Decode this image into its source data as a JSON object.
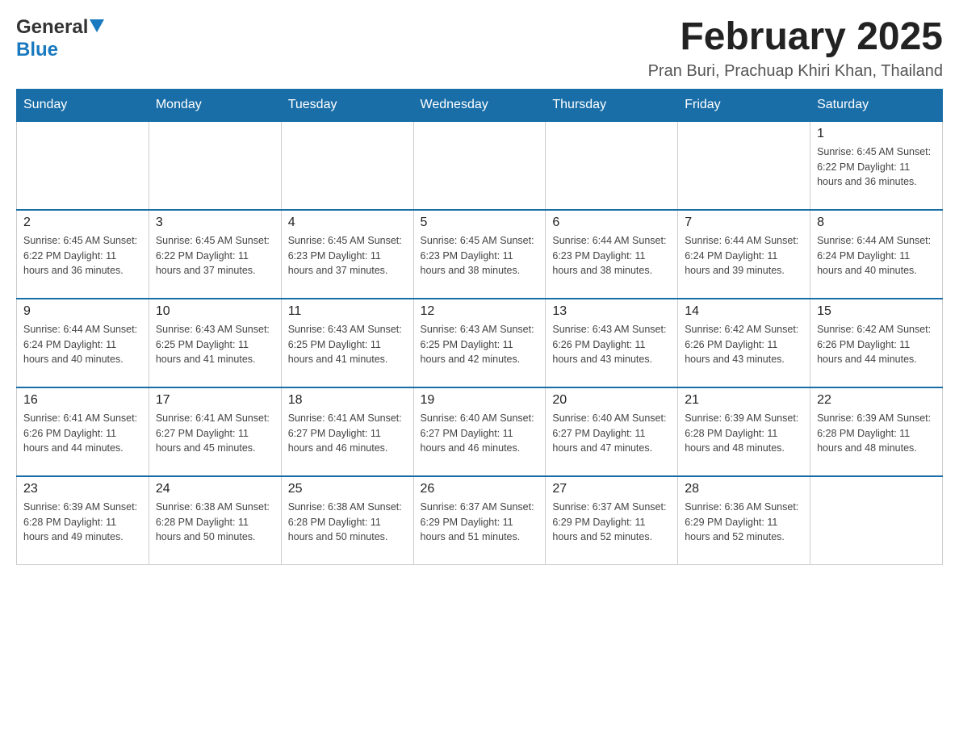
{
  "header": {
    "logo_general": "General",
    "logo_blue": "Blue",
    "month_title": "February 2025",
    "location": "Pran Buri, Prachuap Khiri Khan, Thailand"
  },
  "days_of_week": [
    "Sunday",
    "Monday",
    "Tuesday",
    "Wednesday",
    "Thursday",
    "Friday",
    "Saturday"
  ],
  "weeks": [
    {
      "days": [
        {
          "date": "",
          "info": ""
        },
        {
          "date": "",
          "info": ""
        },
        {
          "date": "",
          "info": ""
        },
        {
          "date": "",
          "info": ""
        },
        {
          "date": "",
          "info": ""
        },
        {
          "date": "",
          "info": ""
        },
        {
          "date": "1",
          "info": "Sunrise: 6:45 AM\nSunset: 6:22 PM\nDaylight: 11 hours\nand 36 minutes."
        }
      ]
    },
    {
      "days": [
        {
          "date": "2",
          "info": "Sunrise: 6:45 AM\nSunset: 6:22 PM\nDaylight: 11 hours\nand 36 minutes."
        },
        {
          "date": "3",
          "info": "Sunrise: 6:45 AM\nSunset: 6:22 PM\nDaylight: 11 hours\nand 37 minutes."
        },
        {
          "date": "4",
          "info": "Sunrise: 6:45 AM\nSunset: 6:23 PM\nDaylight: 11 hours\nand 37 minutes."
        },
        {
          "date": "5",
          "info": "Sunrise: 6:45 AM\nSunset: 6:23 PM\nDaylight: 11 hours\nand 38 minutes."
        },
        {
          "date": "6",
          "info": "Sunrise: 6:44 AM\nSunset: 6:23 PM\nDaylight: 11 hours\nand 38 minutes."
        },
        {
          "date": "7",
          "info": "Sunrise: 6:44 AM\nSunset: 6:24 PM\nDaylight: 11 hours\nand 39 minutes."
        },
        {
          "date": "8",
          "info": "Sunrise: 6:44 AM\nSunset: 6:24 PM\nDaylight: 11 hours\nand 40 minutes."
        }
      ]
    },
    {
      "days": [
        {
          "date": "9",
          "info": "Sunrise: 6:44 AM\nSunset: 6:24 PM\nDaylight: 11 hours\nand 40 minutes."
        },
        {
          "date": "10",
          "info": "Sunrise: 6:43 AM\nSunset: 6:25 PM\nDaylight: 11 hours\nand 41 minutes."
        },
        {
          "date": "11",
          "info": "Sunrise: 6:43 AM\nSunset: 6:25 PM\nDaylight: 11 hours\nand 41 minutes."
        },
        {
          "date": "12",
          "info": "Sunrise: 6:43 AM\nSunset: 6:25 PM\nDaylight: 11 hours\nand 42 minutes."
        },
        {
          "date": "13",
          "info": "Sunrise: 6:43 AM\nSunset: 6:26 PM\nDaylight: 11 hours\nand 43 minutes."
        },
        {
          "date": "14",
          "info": "Sunrise: 6:42 AM\nSunset: 6:26 PM\nDaylight: 11 hours\nand 43 minutes."
        },
        {
          "date": "15",
          "info": "Sunrise: 6:42 AM\nSunset: 6:26 PM\nDaylight: 11 hours\nand 44 minutes."
        }
      ]
    },
    {
      "days": [
        {
          "date": "16",
          "info": "Sunrise: 6:41 AM\nSunset: 6:26 PM\nDaylight: 11 hours\nand 44 minutes."
        },
        {
          "date": "17",
          "info": "Sunrise: 6:41 AM\nSunset: 6:27 PM\nDaylight: 11 hours\nand 45 minutes."
        },
        {
          "date": "18",
          "info": "Sunrise: 6:41 AM\nSunset: 6:27 PM\nDaylight: 11 hours\nand 46 minutes."
        },
        {
          "date": "19",
          "info": "Sunrise: 6:40 AM\nSunset: 6:27 PM\nDaylight: 11 hours\nand 46 minutes."
        },
        {
          "date": "20",
          "info": "Sunrise: 6:40 AM\nSunset: 6:27 PM\nDaylight: 11 hours\nand 47 minutes."
        },
        {
          "date": "21",
          "info": "Sunrise: 6:39 AM\nSunset: 6:28 PM\nDaylight: 11 hours\nand 48 minutes."
        },
        {
          "date": "22",
          "info": "Sunrise: 6:39 AM\nSunset: 6:28 PM\nDaylight: 11 hours\nand 48 minutes."
        }
      ]
    },
    {
      "days": [
        {
          "date": "23",
          "info": "Sunrise: 6:39 AM\nSunset: 6:28 PM\nDaylight: 11 hours\nand 49 minutes."
        },
        {
          "date": "24",
          "info": "Sunrise: 6:38 AM\nSunset: 6:28 PM\nDaylight: 11 hours\nand 50 minutes."
        },
        {
          "date": "25",
          "info": "Sunrise: 6:38 AM\nSunset: 6:28 PM\nDaylight: 11 hours\nand 50 minutes."
        },
        {
          "date": "26",
          "info": "Sunrise: 6:37 AM\nSunset: 6:29 PM\nDaylight: 11 hours\nand 51 minutes."
        },
        {
          "date": "27",
          "info": "Sunrise: 6:37 AM\nSunset: 6:29 PM\nDaylight: 11 hours\nand 52 minutes."
        },
        {
          "date": "28",
          "info": "Sunrise: 6:36 AM\nSunset: 6:29 PM\nDaylight: 11 hours\nand 52 minutes."
        },
        {
          "date": "",
          "info": ""
        }
      ]
    }
  ]
}
